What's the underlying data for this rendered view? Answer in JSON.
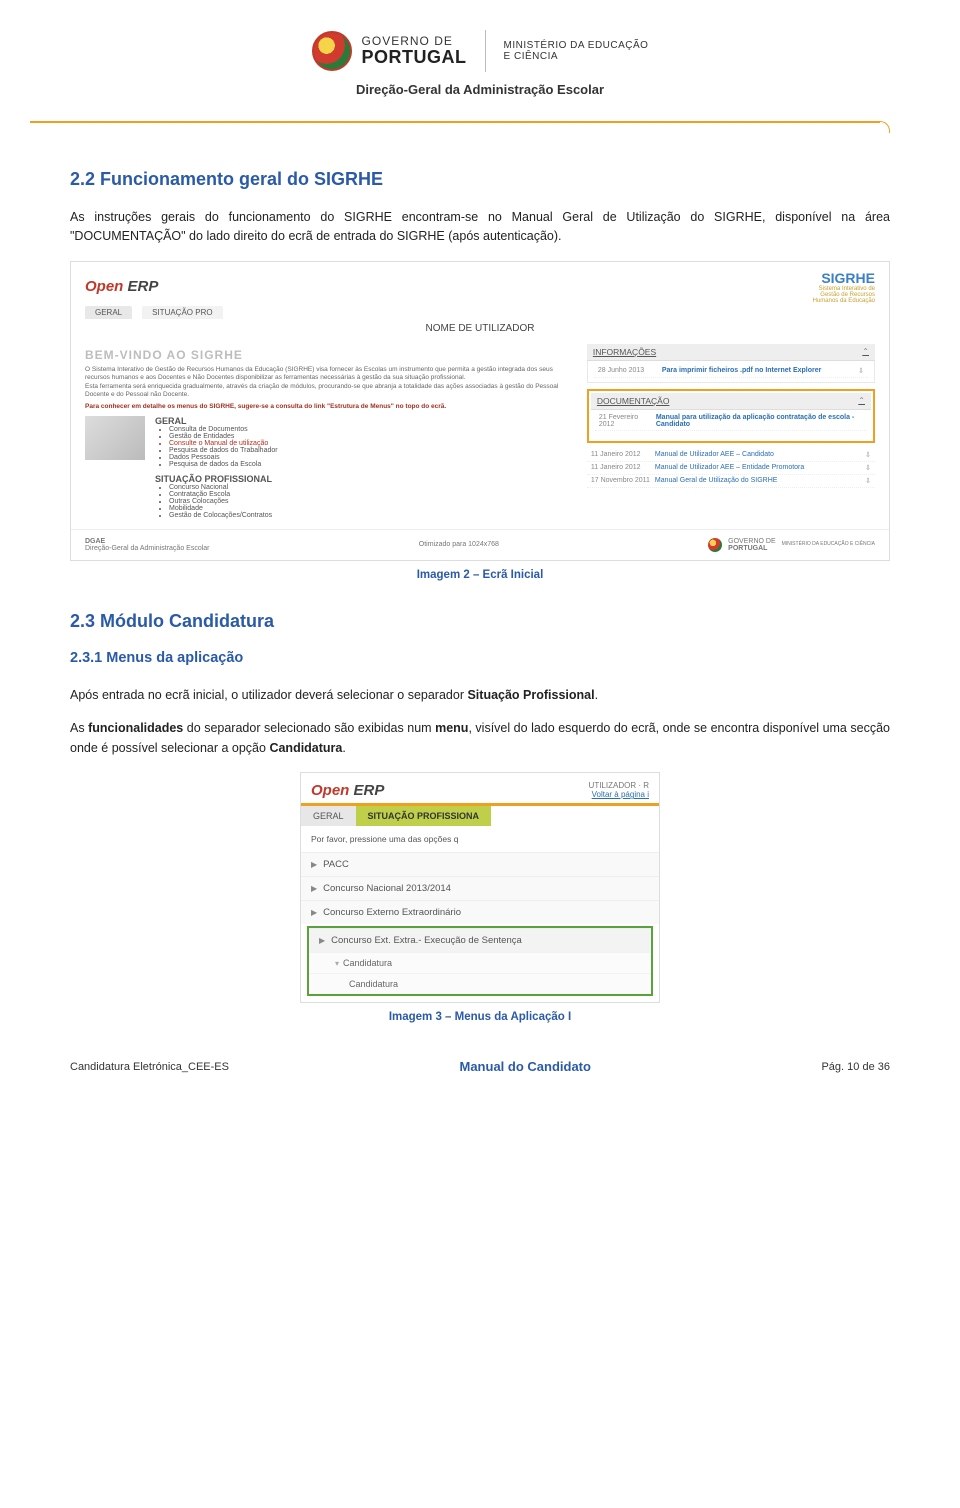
{
  "header": {
    "gov_line1": "GOVERNO DE",
    "gov_line2": "PORTUGAL",
    "ministry_line1": "MINISTÉRIO DA EDUCAÇÃO",
    "ministry_line2": "E CIÊNCIA",
    "subheader": "Direção-Geral da Administração Escolar"
  },
  "section_2_2": {
    "title": "2.2  Funcionamento geral do SIGRHE",
    "para": "As instruções gerais do funcionamento do SIGRHE encontram-se no Manual Geral de Utilização do SIGRHE, disponível na área \"DOCUMENTAÇÃO\" do lado direito do ecrã de entrada do SIGRHE (após autenticação)."
  },
  "shot1": {
    "openerp_o": "Open",
    "openerp_rest": " ERP",
    "sigrhe": "SIGRHE",
    "sigrhe_sub1": "Sistema Interativo de",
    "sigrhe_sub2": "Gestão de Recursos",
    "sigrhe_sub3": "Humanos da Educação",
    "tab_geral": "GERAL",
    "tab_sitpro": "SITUAÇÃO PRO",
    "nome_util": "NOME DE UTILIZADOR",
    "faded_welcome": "BEM-VINDO AO SIGRHE",
    "intro1": "O Sistema Interativo de Gestão de Recursos Humanos da Educação (SIGRHE) visa fornecer às Escolas um instrumento que permita a gestão integrada dos seus recursos humanos e aos Docentes e Não Docentes disponibilizar as ferramentas necessárias à gestão da sua situação profissional.",
    "intro2": "Esta ferramenta será enriquecida gradualmente, através da criação de módulos, procurando-se que abranja a totalidade das ações associadas à gestão do Pessoal Docente e do Pessoal não Docente.",
    "redline": "Para conhecer em detalhe os menus do SIGRHE, sugere-se a consulta do link \"Estrutura de Menus\" no topo do ecrã.",
    "panel_info": "INFORMAÇÕES",
    "info_date": "28 Junho 2013",
    "info_link": "Para imprimir ficheiros .pdf no Internet Explorer",
    "panel_doc": "DOCUMENTAÇÃO",
    "doc1_date": "21 Fevereiro 2012",
    "doc1_link": "Manual para utilização da aplicação contratação de escola - Candidato",
    "doc2_date": "11 Janeiro 2012",
    "doc2_link": "Manual de Utilizador AEE – Candidato",
    "doc3_date": "11 Janeiro 2012",
    "doc3_link": "Manual de Utilizador AEE – Entidade Promotora",
    "doc4_date": "17 Novembro 2011",
    "doc4_link": "Manual Geral de Utilização do SIGRHE",
    "doc4_link2": "Manual Geral de Utilização do SIGRHE",
    "geral_label": "GERAL",
    "geral_items": [
      "Consulta de Documentos",
      "Gestão de Entidades",
      "Consulte o Manual de utilização",
      "Pesquisa de dados do Trabalhador",
      "Dados Pessoais",
      "Pesquisa de dados da Escola"
    ],
    "sitpro_label": "SITUAÇÃO PROFISSIONAL",
    "sitpro_items": [
      "Concurso Nacional",
      "Contratação Escola",
      "Outras Colocações",
      "Mobilidade",
      "Gestão de Colocações/Contratos"
    ],
    "footer_dgae": "DGAE",
    "footer_dgae2": "Direção-Geral da Administração Escolar",
    "footer_center": "Otimizado para 1024x768",
    "footer_gov1": "GOVERNO DE",
    "footer_gov2": "PORTUGAL",
    "footer_min": "MINISTÉRIO DA EDUCAÇÃO E CIÊNCIA"
  },
  "caption1": "Imagem 2 – Ecrã Inicial",
  "section_2_3": {
    "title": "2.3  Módulo Candidatura",
    "subsec_title": "2.3.1  Menus da aplicação",
    "para1": "Após entrada no ecrã inicial, o utilizador deverá selecionar o separador Situação Profissional.",
    "para2": "As funcionalidades do separador selecionado são exibidas num menu, visível do lado esquerdo do ecrã, onde se encontra disponível uma secção onde é possível selecionar a opção Candidatura."
  },
  "shot2": {
    "user_hint": "UTILIZADOR · R",
    "voltar": "Voltar à página i",
    "tab_geral": "GERAL",
    "tab_sitpro": "SITUAÇÃO PROFISSIONA",
    "hint": "Por favor, pressione uma das opções q",
    "items": [
      "PACC",
      "Concurso Nacional 2013/2014",
      "Concurso Externo Extraordinário"
    ],
    "hi_item": "Concurso Ext. Extra.- Execução de Sentença",
    "sub1": "Candidatura",
    "sub2": "Candidatura"
  },
  "caption2": "Imagem 3 – Menus da Aplicação I",
  "footer": {
    "left": "Candidatura Eletrónica_CEE-ES",
    "mid": "Manual do Candidato",
    "right": "Pág. 10 de 36"
  }
}
